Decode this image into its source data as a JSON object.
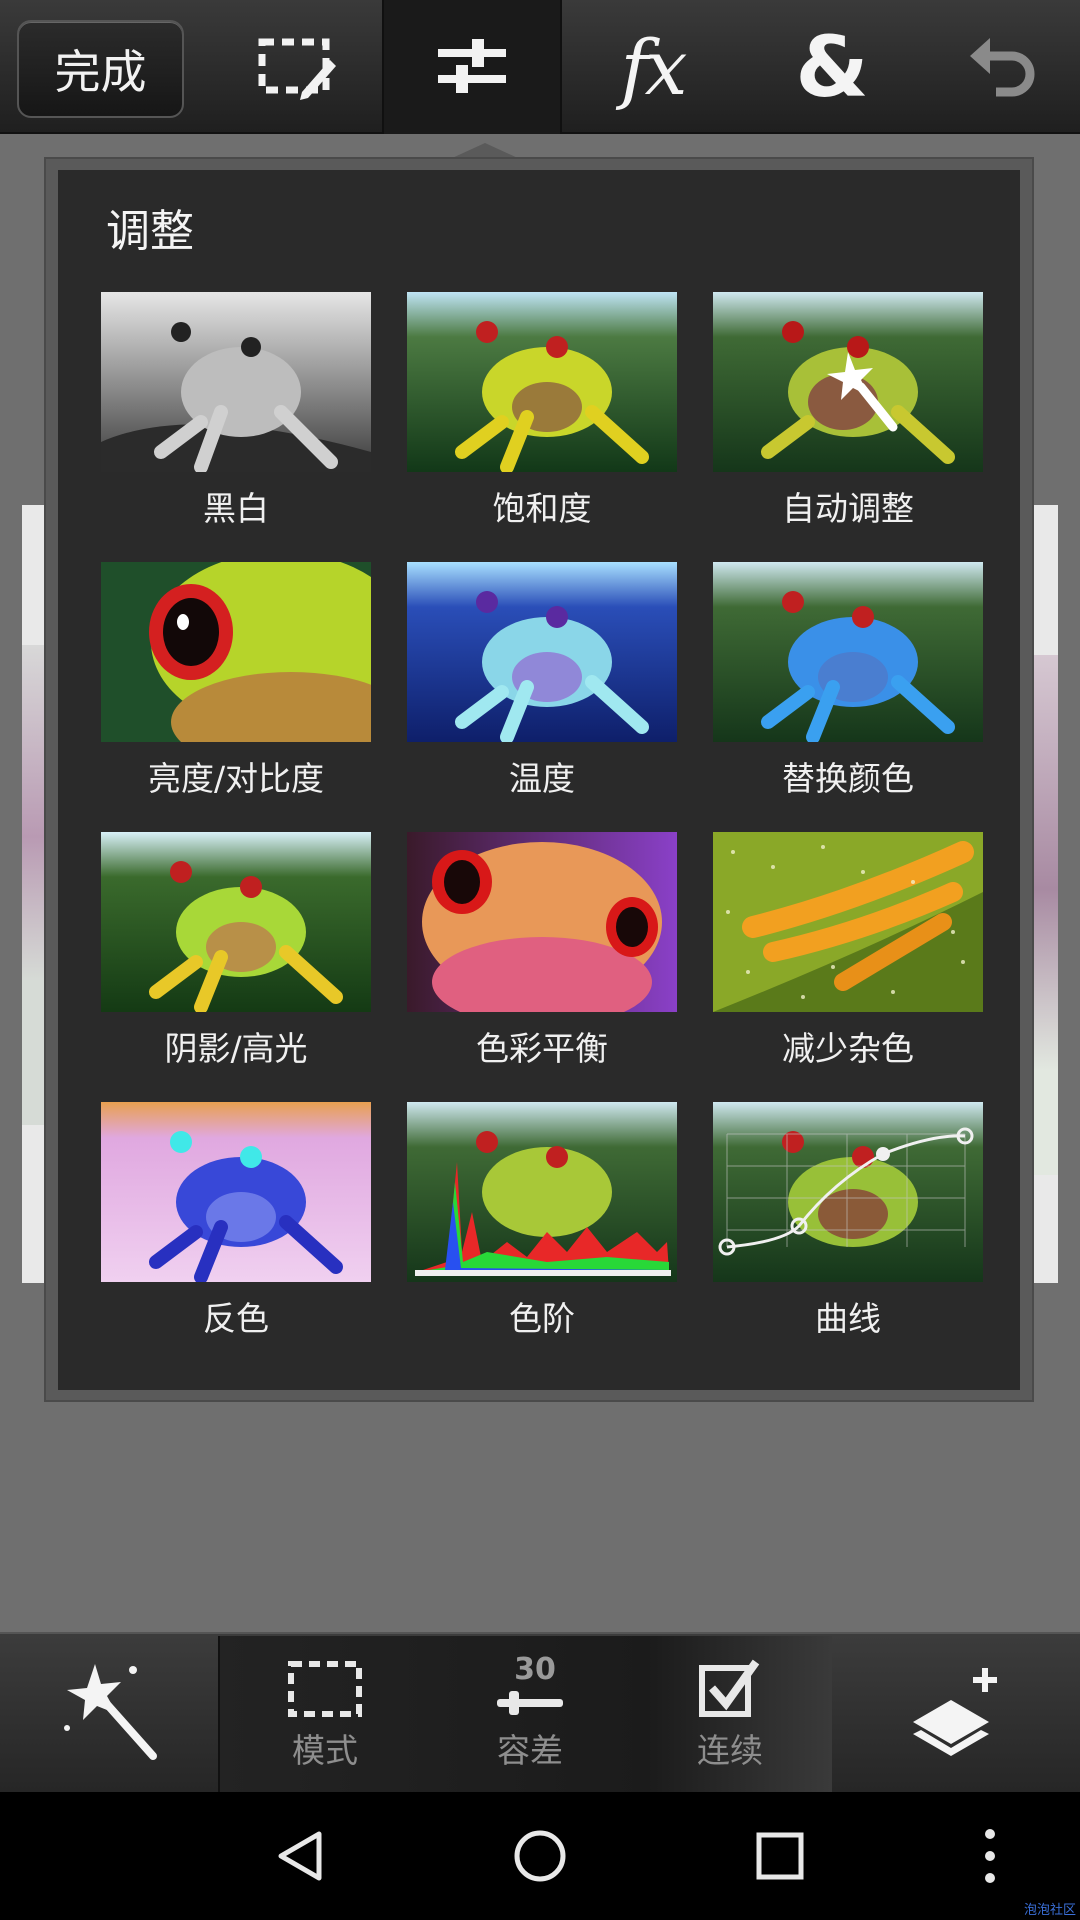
{
  "topbar": {
    "done_label": "完成",
    "tools": [
      {
        "name": "selection-edit-icon"
      },
      {
        "name": "adjustments-icon",
        "active": true
      },
      {
        "name": "effects-icon",
        "label": "fx"
      },
      {
        "name": "combine-icon",
        "label": "&"
      },
      {
        "name": "undo-icon"
      }
    ]
  },
  "panel": {
    "title": "调整",
    "items": [
      {
        "label": "黑白"
      },
      {
        "label": "饱和度"
      },
      {
        "label": "自动调整"
      },
      {
        "label": "亮度/对比度"
      },
      {
        "label": "温度"
      },
      {
        "label": "替换颜色"
      },
      {
        "label": "阴影/高光"
      },
      {
        "label": "色彩平衡"
      },
      {
        "label": "减少杂色"
      },
      {
        "label": "反色"
      },
      {
        "label": "色阶"
      },
      {
        "label": "曲线"
      }
    ]
  },
  "bottombar": {
    "mode_label": "模式",
    "tolerance_label": "容差",
    "tolerance_value": "30",
    "contiguous_label": "连续"
  },
  "watermark": "泡泡社区",
  "colors": {
    "accent_green": "#8fd132",
    "frog_orange": "#f29a1e"
  }
}
